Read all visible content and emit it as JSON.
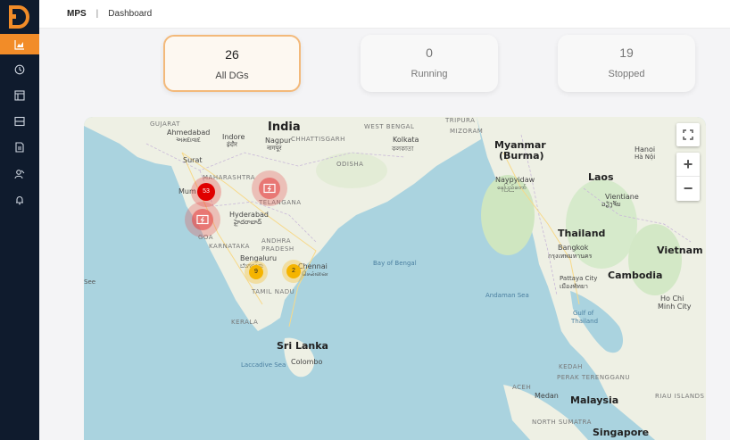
{
  "topbar": {
    "app": "MPS",
    "separator": "|",
    "crumb": "Dashboard"
  },
  "cards": [
    {
      "count": "26",
      "label": "All DGs",
      "selected": true
    },
    {
      "count": "0",
      "label": "Running",
      "selected": false
    },
    {
      "count": "19",
      "label": "Stopped",
      "selected": false
    }
  ],
  "sidebar": {
    "logo": "D",
    "items": [
      "dashboard-icon",
      "clock-icon",
      "layout-icon",
      "list-icon",
      "report-icon",
      "users-icon",
      "bell-icon"
    ]
  },
  "map": {
    "labels": {
      "india": "India",
      "gujarat": "GUJARAT",
      "ahmedabad": "Ahmedabad",
      "ahmedabad_local": "અમદાવાદ",
      "indore": "Indore",
      "indore_local": "इंदौर",
      "nagpur": "Nagpur",
      "nagpur_local": "नागपूर",
      "chhattisgarh": "CHHATTISGARH",
      "tripura": "TRIPURA",
      "mizoram": "MIZORAM",
      "west_bengal": "WEST BENGAL",
      "kolkata": "Kolkata",
      "kolkata_local": "কলকাতা",
      "surat": "Surat",
      "odisha": "ODISHA",
      "maharashtra": "MAHARASHTRA",
      "mumbai": "Mum",
      "telangana": "TELANGANA",
      "hyderabad": "Hyderabad",
      "hyderabad_local": "హైదరాబాద్",
      "goa": "GOA",
      "karnataka": "KARNATAKA",
      "andhra": "ANDHRA",
      "pradesh": "PRADESH",
      "bengaluru": "Bengaluru",
      "bengaluru_local": "ಬೆಂಗಳೂರು",
      "chennai": "Chennai",
      "chennai_local": "சென்னை",
      "tamil_nadu": "TAMIL NADU",
      "kerala": "KERALA",
      "sri_lanka": "Sri Lanka",
      "colombo": "Colombo",
      "laccadive_sea": "Laccadive Sea",
      "bay_of_bengal": "Bay of Bengal",
      "andaman_sea": "Andaman Sea",
      "gulf_of": "Gulf of",
      "thailand_gulf": "Thailand",
      "myanmar": "Myanmar",
      "burma": "(Burma)",
      "naypyidaw": "Naypyidaw",
      "naypyidaw_local": "နေပြည်တော်",
      "laos": "Laos",
      "hanoi": "Hanoi",
      "hanoi_local": "Hà Nội",
      "vientiane": "Vientiane",
      "vientiane_local": "ວຽງຈັນ",
      "thailand": "Thailand",
      "bangkok": "Bangkok",
      "bangkok_local": "กรุงเทพมหานคร",
      "pattaya": "Pattaya City",
      "pattaya_local": "เมืองพัทยา",
      "cambodia": "Cambodia",
      "vietnam": "Vietnam",
      "hochiminh": "Ho Chi",
      "hochiminh2": "Minh City",
      "kedah": "KEDAH",
      "terengganu": "PERAK  TERENGGANU",
      "aceh": "ACEH",
      "medan": "Medan",
      "malaysia": "Malaysia",
      "riau": "RIAU ISLANDS",
      "north_sumatra": "NORTH SUMATRA",
      "singapore": "Singapore",
      "see": "See"
    },
    "markers": [
      {
        "count": "53",
        "color": "#e00000"
      },
      {
        "count": "9",
        "color": "#f5b400"
      },
      {
        "count": "2",
        "color": "#f5b400"
      }
    ],
    "controls": {
      "zoom_in": "+",
      "zoom_out": "−"
    }
  }
}
